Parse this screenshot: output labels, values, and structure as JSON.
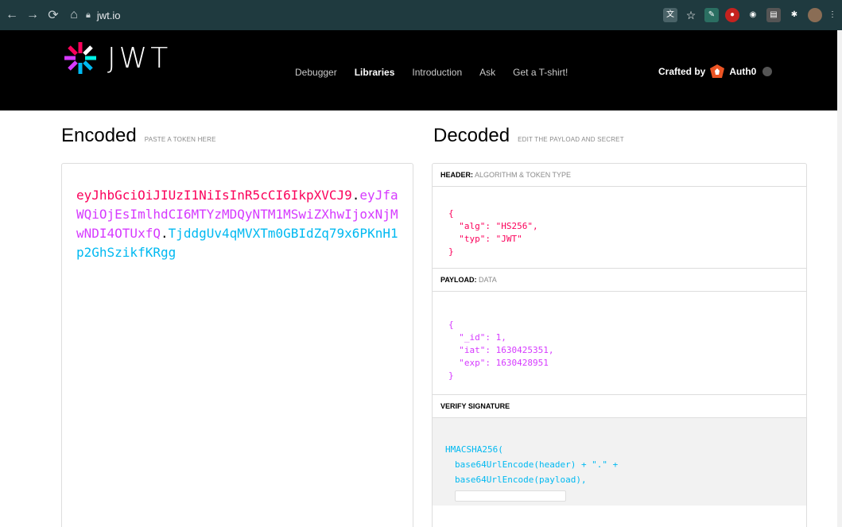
{
  "browser": {
    "url": "jwt.io"
  },
  "site": {
    "logo_text": "JWT",
    "nav": [
      {
        "label": "Debugger",
        "active": false
      },
      {
        "label": "Libraries",
        "active": true
      },
      {
        "label": "Introduction",
        "active": false
      },
      {
        "label": "Ask",
        "active": false
      },
      {
        "label": "Get a T-shirt!",
        "active": false
      }
    ],
    "crafted_by": "Crafted by",
    "crafted_brand": "Auth0"
  },
  "encoded": {
    "title": "Encoded",
    "subtitle": "PASTE A TOKEN HERE",
    "token_header": "eyJhbGciOiJIUzI1NiIsInR5cCI6IkpXVCJ9",
    "token_payload": "eyJfaWQiOjEsImlhdCI6MTYzMDQyNTM1MSwiZXhwIjoxNjMwNDI4OTUxfQ",
    "token_signature": "TjddgUv4qMVXTm0GBIdZq79x6PKnH1p2GhSzikfKRgg",
    "dot": "."
  },
  "decoded": {
    "title": "Decoded",
    "subtitle": "EDIT THE PAYLOAD AND SECRET",
    "header_label": "HEADER:",
    "header_sub": "ALGORITHM & TOKEN TYPE",
    "header_lines": [
      "{",
      "  \"alg\": \"HS256\",",
      "  \"typ\": \"JWT\"",
      "}"
    ],
    "payload_label": "PAYLOAD:",
    "payload_sub": "DATA",
    "payload_lines": [
      "{",
      "  \"_id\": 1,",
      "  \"iat\": 1630425351,",
      "  \"exp\": 1630428951",
      "}"
    ],
    "signature_label": "VERIFY SIGNATURE",
    "signature_lines": [
      "HMACSHA256(",
      "base64UrlEncode(header) + \".\" +",
      "base64UrlEncode(payload),"
    ]
  },
  "colors": {
    "header_token": "#fb015b",
    "payload_token": "#d63aff",
    "signature_token": "#00b9f1"
  }
}
